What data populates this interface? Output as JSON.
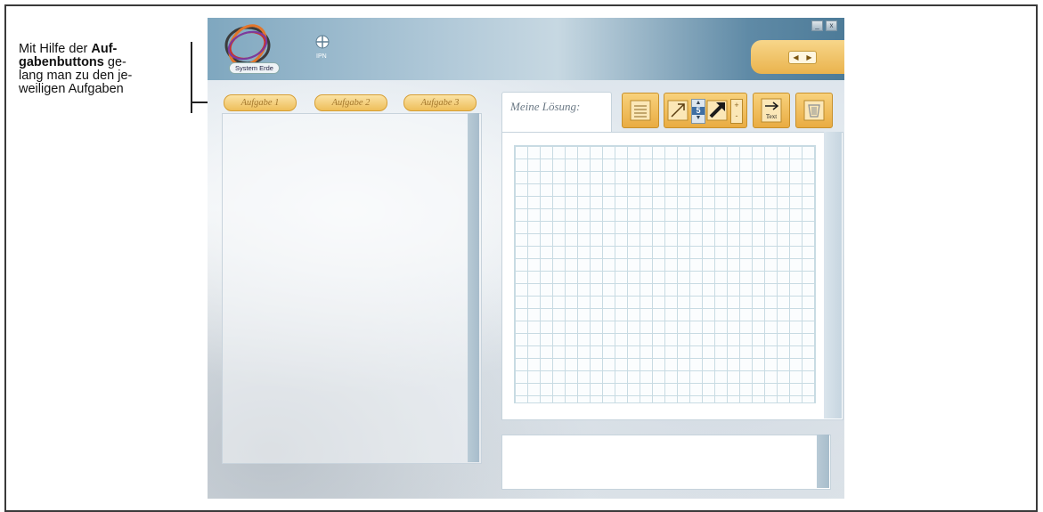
{
  "annotation": {
    "line1_plain": "Mit Hilfe der ",
    "line1_bold": "Auf-",
    "line2_bold": "gabenbuttons",
    "line2_plain": " ge-",
    "line3": "lang man zu den je-",
    "line4": "weiligen Aufgaben"
  },
  "header": {
    "logo_label": "System Erde",
    "ipn_label": "IPN",
    "nav_prev": "◀",
    "nav_next": "▶",
    "minimize": "_",
    "close": "x"
  },
  "task_buttons": [
    "Aufgabe 1",
    "Aufgabe 2",
    "Aufgabe 3"
  ],
  "solution_tab": {
    "label": "Meine Lösung:"
  },
  "toolbar": {
    "text_tool_label": "Text",
    "stroke_width_value": "5",
    "plus": "+",
    "minus": "-"
  },
  "colors": {
    "accent_orange": "#eab34d",
    "header_blue": "#5f8aa6",
    "grid_line": "#c8dbe3"
  }
}
